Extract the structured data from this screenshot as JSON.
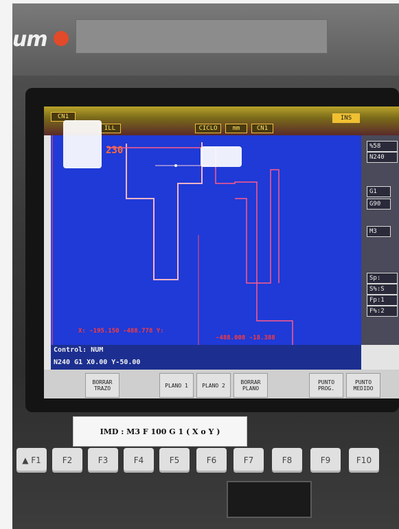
{
  "header": {
    "brand": "um"
  },
  "screen": {
    "tags": {
      "cn1_left": "CN1",
      "ill": "ILL",
      "ciclo": "CICLO",
      "mm": "mm",
      "cn1_mid": "CN1",
      "ins": "INS"
    },
    "marker_value": "230",
    "right_panel": {
      "item1": "%58",
      "item2": "N240",
      "item3": "G1",
      "item4": "G90",
      "item5": "M3",
      "item6": "Sp:",
      "item7": "S%:S",
      "item8": "Fp:1",
      "item9": "F%:2"
    },
    "coords": {
      "left_text": "X: -195.150  -488.778  Y:",
      "right_text": "-488.008  -18.388"
    },
    "control_label": "Control: NUM",
    "program_line": "N240 G1 X0.00 Y-50.00",
    "softkeys": {
      "borrar_trazo": "BORRAR TRAZO",
      "plano1": "PLANO 1",
      "plano2": "PLANO 2",
      "borrar_plano": "BORRAR PLANO",
      "punto_prog": "PUNTO PROG.",
      "punto_medido": "PUNTO MEDIDO"
    }
  },
  "imd_label": "IMD : M3 F 100 G 1 ( X o Y )",
  "fkeys": [
    "▲ F1",
    "F2",
    "F3",
    "F4",
    "F5",
    "F6",
    "F7",
    "F8",
    "F9",
    "F10"
  ]
}
